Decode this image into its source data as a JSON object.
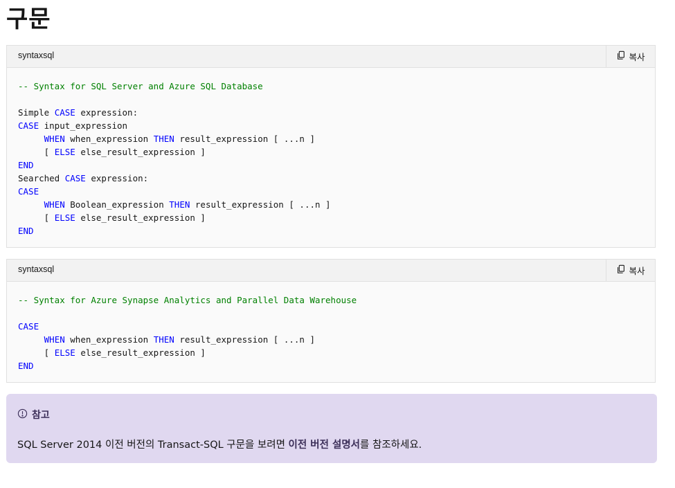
{
  "page": {
    "title": "구문"
  },
  "code_blocks": [
    {
      "language": "syntaxsql",
      "copy_label": "복사",
      "lines": [
        [
          {
            "t": "-- Syntax for SQL Server and Azure SQL Database",
            "c": "cm"
          }
        ],
        [],
        [
          {
            "t": "Simple ",
            "c": ""
          },
          {
            "t": "CASE",
            "c": "kw"
          },
          {
            "t": " expression:",
            "c": ""
          }
        ],
        [
          {
            "t": "CASE",
            "c": "kw"
          },
          {
            "t": " input_expression",
            "c": ""
          }
        ],
        [
          {
            "t": "     ",
            "c": ""
          },
          {
            "t": "WHEN",
            "c": "kw"
          },
          {
            "t": " when_expression ",
            "c": ""
          },
          {
            "t": "THEN",
            "c": "kw"
          },
          {
            "t": " result_expression [ ...n ]",
            "c": ""
          }
        ],
        [
          {
            "t": "     [ ",
            "c": ""
          },
          {
            "t": "ELSE",
            "c": "kw"
          },
          {
            "t": " else_result_expression ]",
            "c": ""
          }
        ],
        [
          {
            "t": "END",
            "c": "kw"
          }
        ],
        [
          {
            "t": "Searched ",
            "c": ""
          },
          {
            "t": "CASE",
            "c": "kw"
          },
          {
            "t": " expression:",
            "c": ""
          }
        ],
        [
          {
            "t": "CASE",
            "c": "kw"
          }
        ],
        [
          {
            "t": "     ",
            "c": ""
          },
          {
            "t": "WHEN",
            "c": "kw"
          },
          {
            "t": " Boolean_expression ",
            "c": ""
          },
          {
            "t": "THEN",
            "c": "kw"
          },
          {
            "t": " result_expression [ ...n ]",
            "c": ""
          }
        ],
        [
          {
            "t": "     [ ",
            "c": ""
          },
          {
            "t": "ELSE",
            "c": "kw"
          },
          {
            "t": " else_result_expression ]",
            "c": ""
          }
        ],
        [
          {
            "t": "END",
            "c": "kw"
          }
        ]
      ]
    },
    {
      "language": "syntaxsql",
      "copy_label": "복사",
      "lines": [
        [
          {
            "t": "-- Syntax for Azure Synapse Analytics and Parallel Data Warehouse",
            "c": "cm"
          }
        ],
        [],
        [
          {
            "t": "CASE",
            "c": "kw"
          }
        ],
        [
          {
            "t": "     ",
            "c": ""
          },
          {
            "t": "WHEN",
            "c": "kw"
          },
          {
            "t": " when_expression ",
            "c": ""
          },
          {
            "t": "THEN",
            "c": "kw"
          },
          {
            "t": " result_expression [ ...n ]",
            "c": ""
          }
        ],
        [
          {
            "t": "     [ ",
            "c": ""
          },
          {
            "t": "ELSE",
            "c": "kw"
          },
          {
            "t": " else_result_expression ]",
            "c": ""
          }
        ],
        [
          {
            "t": "END",
            "c": "kw"
          }
        ]
      ]
    }
  ],
  "note": {
    "icon": "info-circle-icon",
    "heading": "참고",
    "text_before": "SQL Server 2014 이전 버전의 Transact-SQL 구문을 보려면 ",
    "link_text": "이전 버전 설명서",
    "text_after": "를 참조하세요."
  },
  "colors": {
    "keyword": "#0101fd",
    "comment": "#008000",
    "note_bg": "#e0d8f0"
  }
}
